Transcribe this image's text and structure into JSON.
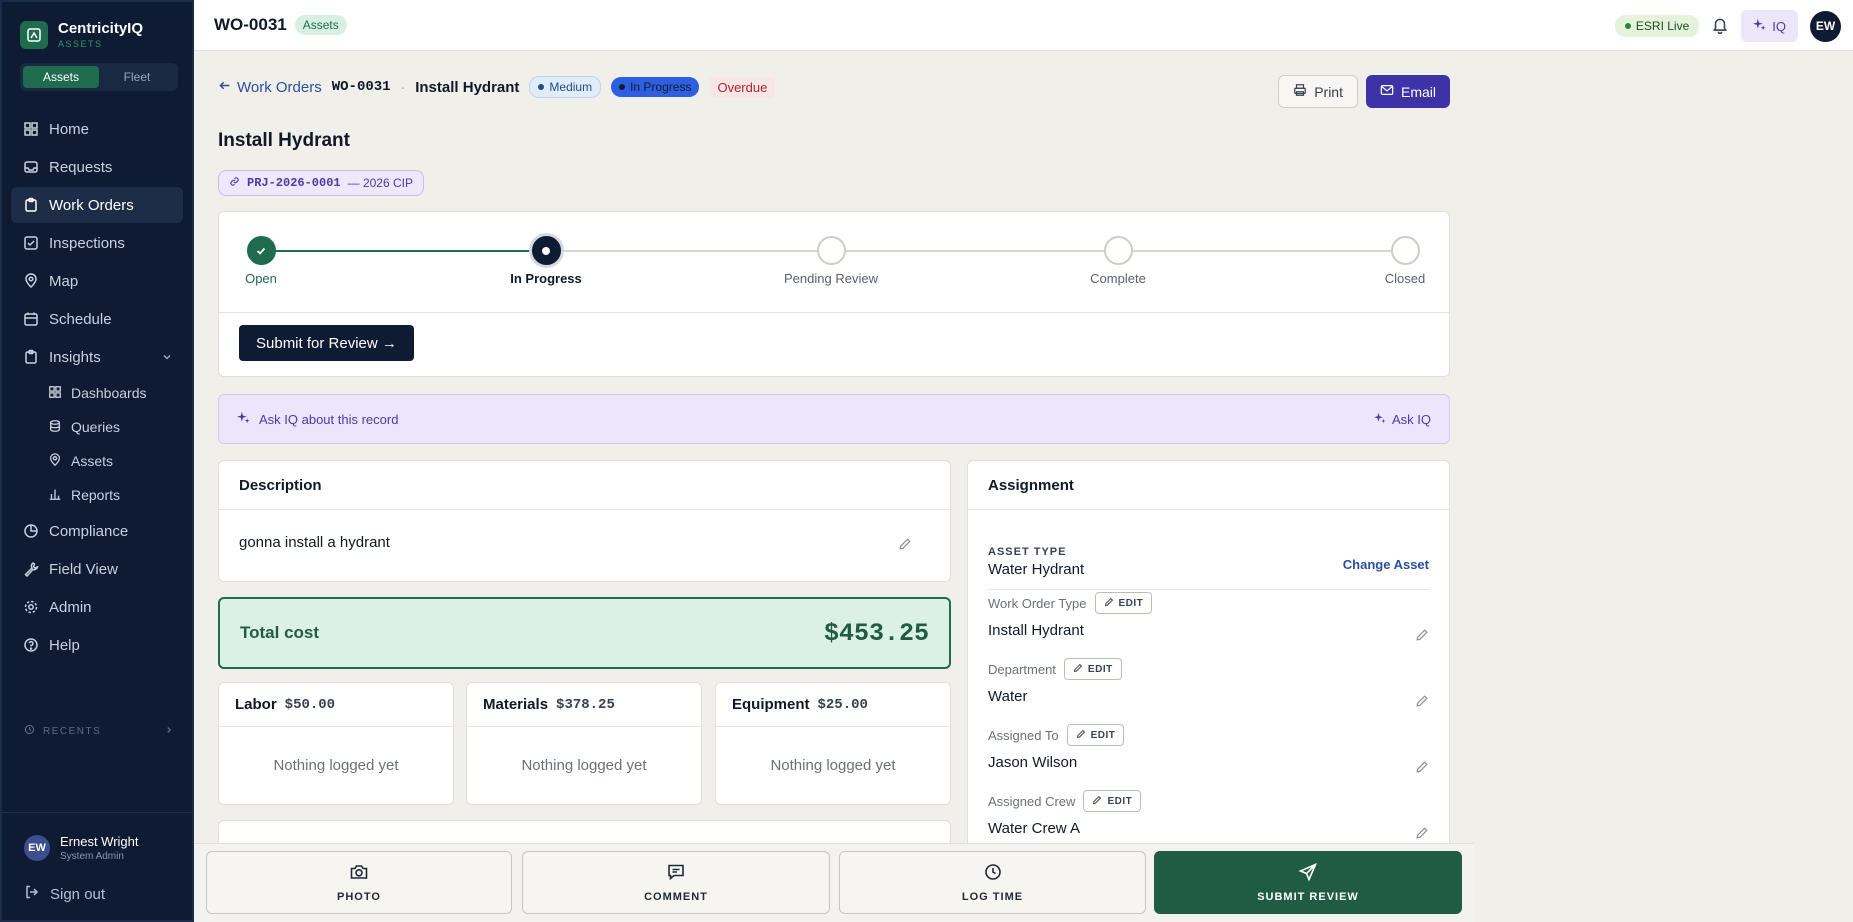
{
  "app": {
    "name": "CentricityIQ",
    "module": "ASSETS"
  },
  "sidebar": {
    "segments": [
      {
        "label": "Assets",
        "active": true
      },
      {
        "label": "Fleet",
        "active": false
      }
    ],
    "items": [
      {
        "label": "Home",
        "icon": "grid-icon"
      },
      {
        "label": "Requests",
        "icon": "inbox-icon"
      },
      {
        "label": "Work Orders",
        "icon": "clipboard-icon",
        "active": true
      },
      {
        "label": "Inspections",
        "icon": "check-square-icon"
      },
      {
        "label": "Map",
        "icon": "map-pin-icon"
      },
      {
        "label": "Schedule",
        "icon": "calendar-icon"
      },
      {
        "label": "Insights",
        "icon": "clipboard-icon",
        "expanded": true
      },
      {
        "label": "Compliance",
        "icon": "pie-icon"
      },
      {
        "label": "Field View",
        "icon": "wrench-icon"
      },
      {
        "label": "Admin",
        "icon": "gear-icon"
      },
      {
        "label": "Help",
        "icon": "help-icon"
      }
    ],
    "insights_sub": [
      {
        "label": "Dashboards"
      },
      {
        "label": "Queries"
      },
      {
        "label": "Assets"
      },
      {
        "label": "Reports"
      }
    ],
    "recents_label": "RECENTS",
    "user": {
      "initials": "EW",
      "name": "Ernest Wright",
      "role": "System Admin"
    },
    "signout_label": "Sign out"
  },
  "topbar": {
    "title": "WO-0031",
    "module_chip": "Assets",
    "esri_label": "ESRI Live",
    "iq_label": "IQ",
    "avatar": "EW"
  },
  "header": {
    "back_label": "Work Orders",
    "wo_id": "WO-0031",
    "separator": "·",
    "wo_name": "Install Hydrant",
    "priority": "Medium",
    "status": "In Progress",
    "overdue": "Overdue",
    "print_label": "Print",
    "email_label": "Email",
    "title": "Install Hydrant",
    "project_id": "PRJ-2026-0001",
    "project_name": "— 2026 CIP"
  },
  "workflow": {
    "steps": [
      {
        "label": "Open",
        "state": "done"
      },
      {
        "label": "In Progress",
        "state": "current"
      },
      {
        "label": "Pending Review",
        "state": "todo"
      },
      {
        "label": "Complete",
        "state": "todo"
      },
      {
        "label": "Closed",
        "state": "todo"
      }
    ],
    "submit_label": "Submit for Review →"
  },
  "askiq": {
    "prompt": "Ask IQ about this record",
    "button": "Ask IQ"
  },
  "description": {
    "heading": "Description",
    "text": "gonna install a hydrant"
  },
  "costs": {
    "total_label": "Total cost",
    "total_value": "$453.25",
    "items": [
      {
        "label": "Labor",
        "value": "$50.00",
        "empty": "Nothing logged yet"
      },
      {
        "label": "Materials",
        "value": "$378.25",
        "empty": "Nothing logged yet"
      },
      {
        "label": "Equipment",
        "value": "$25.00",
        "empty": "Nothing logged yet"
      }
    ]
  },
  "assignment": {
    "heading": "Assignment",
    "asset_type_label": "ASSET TYPE",
    "asset_type_value": "Water Hydrant",
    "change_asset": "Change Asset",
    "edit_label": "EDIT",
    "fields": [
      {
        "label": "Work Order Type",
        "value": "Install Hydrant"
      },
      {
        "label": "Department",
        "value": "Water"
      },
      {
        "label": "Assigned To",
        "value": "Jason Wilson"
      },
      {
        "label": "Assigned Crew",
        "value": "Water Crew A"
      }
    ]
  },
  "actions": [
    {
      "label": "PHOTO",
      "icon": "camera-icon"
    },
    {
      "label": "COMMENT",
      "icon": "comment-icon"
    },
    {
      "label": "LOG TIME",
      "icon": "clock-icon"
    },
    {
      "label": "SUBMIT REVIEW",
      "icon": "send-icon"
    }
  ],
  "colors": {
    "brand_green": "#1f6b4e",
    "navy": "#0f1b33",
    "purple": "#3d33a6",
    "overdue_red": "#b4222c"
  }
}
